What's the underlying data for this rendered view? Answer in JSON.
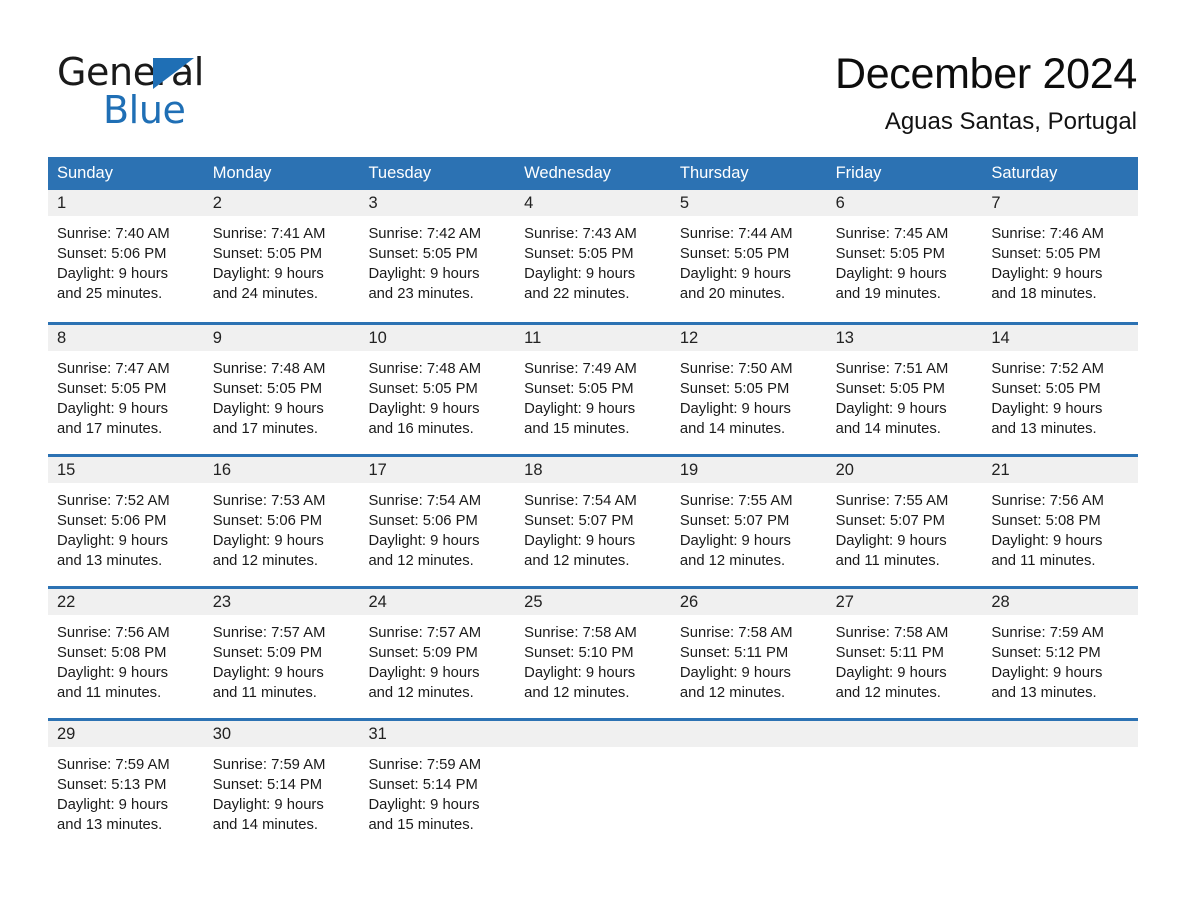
{
  "brand": {
    "name_part1": "General",
    "name_part2": "Blue",
    "triangle_color": "#1f6fb5"
  },
  "header": {
    "month_title": "December 2024",
    "location": "Aguas Santas, Portugal"
  },
  "theme": {
    "header_blue": "#2c72b3",
    "day_band_gray": "#f0f0f0",
    "text_color": "#1a1a1a"
  },
  "calendar": {
    "weekdays": [
      "Sunday",
      "Monday",
      "Tuesday",
      "Wednesday",
      "Thursday",
      "Friday",
      "Saturday"
    ],
    "weeks": [
      [
        {
          "day": "1",
          "sunrise": "Sunrise: 7:40 AM",
          "sunset": "Sunset: 5:06 PM",
          "daylight_line1": "Daylight: 9 hours",
          "daylight_line2": "and 25 minutes."
        },
        {
          "day": "2",
          "sunrise": "Sunrise: 7:41 AM",
          "sunset": "Sunset: 5:05 PM",
          "daylight_line1": "Daylight: 9 hours",
          "daylight_line2": "and 24 minutes."
        },
        {
          "day": "3",
          "sunrise": "Sunrise: 7:42 AM",
          "sunset": "Sunset: 5:05 PM",
          "daylight_line1": "Daylight: 9 hours",
          "daylight_line2": "and 23 minutes."
        },
        {
          "day": "4",
          "sunrise": "Sunrise: 7:43 AM",
          "sunset": "Sunset: 5:05 PM",
          "daylight_line1": "Daylight: 9 hours",
          "daylight_line2": "and 22 minutes."
        },
        {
          "day": "5",
          "sunrise": "Sunrise: 7:44 AM",
          "sunset": "Sunset: 5:05 PM",
          "daylight_line1": "Daylight: 9 hours",
          "daylight_line2": "and 20 minutes."
        },
        {
          "day": "6",
          "sunrise": "Sunrise: 7:45 AM",
          "sunset": "Sunset: 5:05 PM",
          "daylight_line1": "Daylight: 9 hours",
          "daylight_line2": "and 19 minutes."
        },
        {
          "day": "7",
          "sunrise": "Sunrise: 7:46 AM",
          "sunset": "Sunset: 5:05 PM",
          "daylight_line1": "Daylight: 9 hours",
          "daylight_line2": "and 18 minutes."
        }
      ],
      [
        {
          "day": "8",
          "sunrise": "Sunrise: 7:47 AM",
          "sunset": "Sunset: 5:05 PM",
          "daylight_line1": "Daylight: 9 hours",
          "daylight_line2": "and 17 minutes."
        },
        {
          "day": "9",
          "sunrise": "Sunrise: 7:48 AM",
          "sunset": "Sunset: 5:05 PM",
          "daylight_line1": "Daylight: 9 hours",
          "daylight_line2": "and 17 minutes."
        },
        {
          "day": "10",
          "sunrise": "Sunrise: 7:48 AM",
          "sunset": "Sunset: 5:05 PM",
          "daylight_line1": "Daylight: 9 hours",
          "daylight_line2": "and 16 minutes."
        },
        {
          "day": "11",
          "sunrise": "Sunrise: 7:49 AM",
          "sunset": "Sunset: 5:05 PM",
          "daylight_line1": "Daylight: 9 hours",
          "daylight_line2": "and 15 minutes."
        },
        {
          "day": "12",
          "sunrise": "Sunrise: 7:50 AM",
          "sunset": "Sunset: 5:05 PM",
          "daylight_line1": "Daylight: 9 hours",
          "daylight_line2": "and 14 minutes."
        },
        {
          "day": "13",
          "sunrise": "Sunrise: 7:51 AM",
          "sunset": "Sunset: 5:05 PM",
          "daylight_line1": "Daylight: 9 hours",
          "daylight_line2": "and 14 minutes."
        },
        {
          "day": "14",
          "sunrise": "Sunrise: 7:52 AM",
          "sunset": "Sunset: 5:05 PM",
          "daylight_line1": "Daylight: 9 hours",
          "daylight_line2": "and 13 minutes."
        }
      ],
      [
        {
          "day": "15",
          "sunrise": "Sunrise: 7:52 AM",
          "sunset": "Sunset: 5:06 PM",
          "daylight_line1": "Daylight: 9 hours",
          "daylight_line2": "and 13 minutes."
        },
        {
          "day": "16",
          "sunrise": "Sunrise: 7:53 AM",
          "sunset": "Sunset: 5:06 PM",
          "daylight_line1": "Daylight: 9 hours",
          "daylight_line2": "and 12 minutes."
        },
        {
          "day": "17",
          "sunrise": "Sunrise: 7:54 AM",
          "sunset": "Sunset: 5:06 PM",
          "daylight_line1": "Daylight: 9 hours",
          "daylight_line2": "and 12 minutes."
        },
        {
          "day": "18",
          "sunrise": "Sunrise: 7:54 AM",
          "sunset": "Sunset: 5:07 PM",
          "daylight_line1": "Daylight: 9 hours",
          "daylight_line2": "and 12 minutes."
        },
        {
          "day": "19",
          "sunrise": "Sunrise: 7:55 AM",
          "sunset": "Sunset: 5:07 PM",
          "daylight_line1": "Daylight: 9 hours",
          "daylight_line2": "and 12 minutes."
        },
        {
          "day": "20",
          "sunrise": "Sunrise: 7:55 AM",
          "sunset": "Sunset: 5:07 PM",
          "daylight_line1": "Daylight: 9 hours",
          "daylight_line2": "and 11 minutes."
        },
        {
          "day": "21",
          "sunrise": "Sunrise: 7:56 AM",
          "sunset": "Sunset: 5:08 PM",
          "daylight_line1": "Daylight: 9 hours",
          "daylight_line2": "and 11 minutes."
        }
      ],
      [
        {
          "day": "22",
          "sunrise": "Sunrise: 7:56 AM",
          "sunset": "Sunset: 5:08 PM",
          "daylight_line1": "Daylight: 9 hours",
          "daylight_line2": "and 11 minutes."
        },
        {
          "day": "23",
          "sunrise": "Sunrise: 7:57 AM",
          "sunset": "Sunset: 5:09 PM",
          "daylight_line1": "Daylight: 9 hours",
          "daylight_line2": "and 11 minutes."
        },
        {
          "day": "24",
          "sunrise": "Sunrise: 7:57 AM",
          "sunset": "Sunset: 5:09 PM",
          "daylight_line1": "Daylight: 9 hours",
          "daylight_line2": "and 12 minutes."
        },
        {
          "day": "25",
          "sunrise": "Sunrise: 7:58 AM",
          "sunset": "Sunset: 5:10 PM",
          "daylight_line1": "Daylight: 9 hours",
          "daylight_line2": "and 12 minutes."
        },
        {
          "day": "26",
          "sunrise": "Sunrise: 7:58 AM",
          "sunset": "Sunset: 5:11 PM",
          "daylight_line1": "Daylight: 9 hours",
          "daylight_line2": "and 12 minutes."
        },
        {
          "day": "27",
          "sunrise": "Sunrise: 7:58 AM",
          "sunset": "Sunset: 5:11 PM",
          "daylight_line1": "Daylight: 9 hours",
          "daylight_line2": "and 12 minutes."
        },
        {
          "day": "28",
          "sunrise": "Sunrise: 7:59 AM",
          "sunset": "Sunset: 5:12 PM",
          "daylight_line1": "Daylight: 9 hours",
          "daylight_line2": "and 13 minutes."
        }
      ],
      [
        {
          "day": "29",
          "sunrise": "Sunrise: 7:59 AM",
          "sunset": "Sunset: 5:13 PM",
          "daylight_line1": "Daylight: 9 hours",
          "daylight_line2": "and 13 minutes."
        },
        {
          "day": "30",
          "sunrise": "Sunrise: 7:59 AM",
          "sunset": "Sunset: 5:14 PM",
          "daylight_line1": "Daylight: 9 hours",
          "daylight_line2": "and 14 minutes."
        },
        {
          "day": "31",
          "sunrise": "Sunrise: 7:59 AM",
          "sunset": "Sunset: 5:14 PM",
          "daylight_line1": "Daylight: 9 hours",
          "daylight_line2": "and 15 minutes."
        },
        {
          "day": "",
          "sunrise": "",
          "sunset": "",
          "daylight_line1": "",
          "daylight_line2": ""
        },
        {
          "day": "",
          "sunrise": "",
          "sunset": "",
          "daylight_line1": "",
          "daylight_line2": ""
        },
        {
          "day": "",
          "sunrise": "",
          "sunset": "",
          "daylight_line1": "",
          "daylight_line2": ""
        },
        {
          "day": "",
          "sunrise": "",
          "sunset": "",
          "daylight_line1": "",
          "daylight_line2": ""
        }
      ]
    ]
  }
}
